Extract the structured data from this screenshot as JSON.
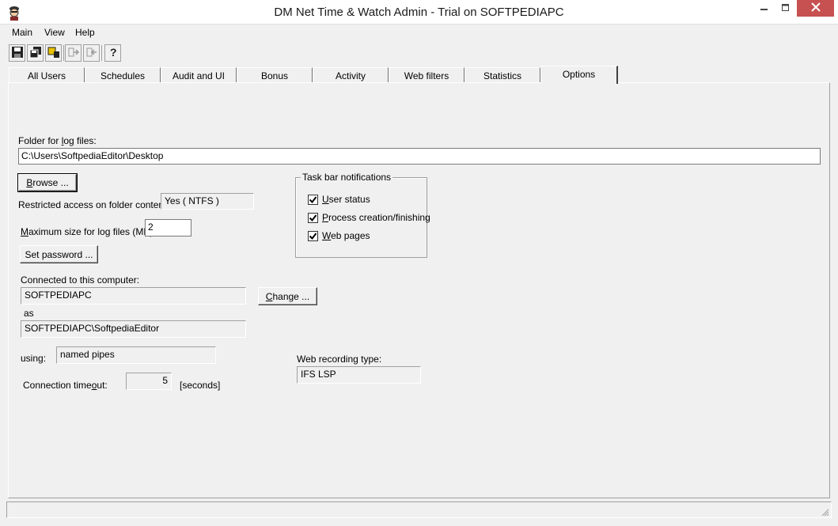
{
  "window": {
    "title": "DM Net Time & Watch Admin - Trial on SOFTPEDIAPC"
  },
  "menu": [
    "Main",
    "View",
    "Help"
  ],
  "toolbar": {
    "icons": [
      "save-icon",
      "copy-icon",
      "find-icon",
      "forward-icon",
      "back-icon",
      "help-icon"
    ]
  },
  "tabs": [
    {
      "label": "All Users"
    },
    {
      "label": "Schedules"
    },
    {
      "label": "Audit and UI"
    },
    {
      "label": "Bonus"
    },
    {
      "label": "Activity"
    },
    {
      "label": "Web filters"
    },
    {
      "label": "Statistics"
    },
    {
      "label": "Options",
      "active": true
    }
  ],
  "options": {
    "log_folder": {
      "label_pre": "Folder for ",
      "label_u": "l",
      "label_post": "og files:",
      "value": "C:\\Users\\SoftpediaEditor\\Desktop"
    },
    "browse_button": {
      "u": "B",
      "rest": "rowse ..."
    },
    "restricted_access": {
      "label": "Restricted access on folder content:",
      "value": "Yes  ( NTFS )"
    },
    "max_log_size": {
      "label_u": "M",
      "label_rest": "aximum size for log files (MB):",
      "value": "2"
    },
    "set_password_button": "Set password ...",
    "connected": {
      "label": "Connected to this computer:",
      "computer": "SOFTPEDIAPC",
      "as_label": "as",
      "user": "SOFTPEDIAPC\\SoftpediaEditor",
      "using_label": "using:",
      "using_value": "named pipes"
    },
    "change_button": {
      "u": "C",
      "rest": "hange ..."
    },
    "connection_timeout": {
      "label_pre": "Connection time",
      "label_u": "o",
      "label_post": "ut:",
      "value": "5",
      "unit": "[seconds]"
    },
    "taskbar": {
      "title": "Task bar notifications",
      "items": [
        {
          "u": "U",
          "rest": "ser status",
          "checked": true
        },
        {
          "u": "P",
          "rest": "rocess creation/finishing",
          "checked": true
        },
        {
          "u": "W",
          "rest": "eb pages",
          "checked": true
        }
      ]
    },
    "web_recording": {
      "label": "Web recording type:",
      "value": "IFS LSP"
    }
  },
  "colors": {
    "background": "#f0f0f0",
    "close_button": "#c75050"
  }
}
